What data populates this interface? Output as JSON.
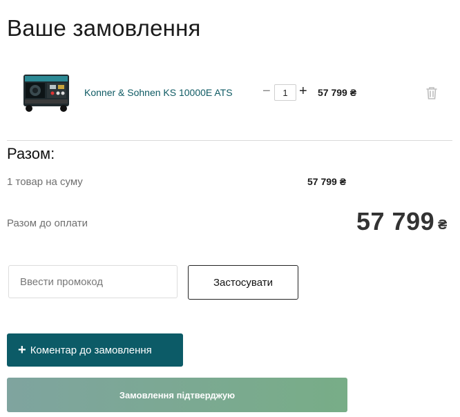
{
  "page": {
    "title": "Ваше замовлення"
  },
  "cart": {
    "items": [
      {
        "name": "Konner & Sohnen KS 10000E ATS",
        "quantity": "1",
        "price": "57 799 ₴",
        "image_icon": "generator-icon"
      }
    ],
    "minus_symbol": "−",
    "plus_symbol": "+"
  },
  "summary": {
    "title": "Разом:",
    "goods_label": "1 товар на суму",
    "goods_value": "57 799 ₴",
    "total_label": "Разом до оплати",
    "total_value": "57 799",
    "currency": "₴"
  },
  "promo": {
    "placeholder": "Ввести промокод",
    "apply_label": "Застосувати"
  },
  "actions": {
    "comment_label": "Коментар до замовлення",
    "confirm_label": "Замовлення підтверджую"
  },
  "colors": {
    "accent": "#0c5b67",
    "confirm_gradient_start": "#7fa49f",
    "confirm_gradient_end": "#78ad87",
    "product_link": "#0e5a63"
  }
}
